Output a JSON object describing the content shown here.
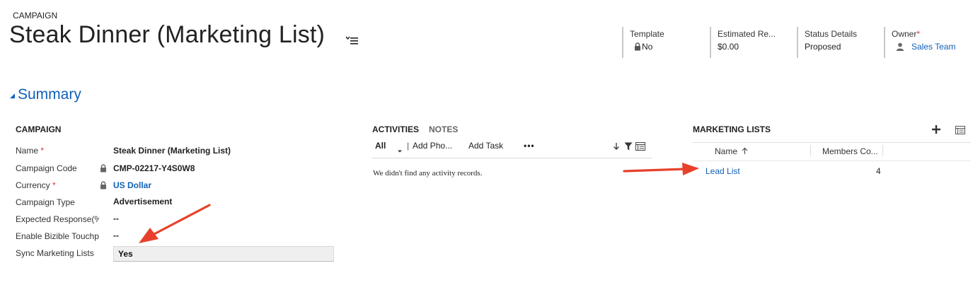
{
  "header": {
    "entity_type": "CAMPAIGN",
    "title": "Steak Dinner (Marketing List)",
    "fields": [
      {
        "label": "Template",
        "value": "No",
        "locked": true
      },
      {
        "label": "Estimated Re...",
        "value": "$0.00"
      },
      {
        "label": "Status Details",
        "value": "Proposed"
      },
      {
        "label": "Owner",
        "required_marker": "*",
        "value": "Sales Team",
        "icon": "user-icon"
      }
    ]
  },
  "summary": {
    "title": "Summary",
    "toggle_glyph": "◢"
  },
  "campaign": {
    "section_title": "CAMPAIGN",
    "fields": [
      {
        "label": "Name",
        "required_marker": "*",
        "value": "Steak Dinner (Marketing List)"
      },
      {
        "label": "Campaign Code",
        "value": "CMP-02217-Y4S0W8",
        "locked": true
      },
      {
        "label": "Currency",
        "required_marker": "*",
        "value": "US Dollar",
        "locked": true
      },
      {
        "label": "Campaign Type",
        "value": "Advertisement"
      },
      {
        "label": "Expected Response(%)",
        "value": "--"
      },
      {
        "label": "Enable Bizible Touchpoints",
        "value": "--"
      },
      {
        "label": "Sync Marketing Lists",
        "value": "Yes"
      }
    ]
  },
  "activities": {
    "tabs": [
      "ACTIVITIES",
      "NOTES"
    ],
    "filter": "All",
    "add_phone": "Add Pho...",
    "add_task": "Add Task",
    "more": "•••",
    "empty_message": "We didn't find any activity records."
  },
  "marketing_lists": {
    "section_title": "MARKETING LISTS",
    "columns": [
      "Name",
      "Members Co..."
    ],
    "rows": [
      {
        "name": "Lead List",
        "members": "4"
      }
    ]
  },
  "colors": {
    "link": "#1160b7",
    "required": "#d33",
    "annotation_arrow": "#e8402a"
  }
}
